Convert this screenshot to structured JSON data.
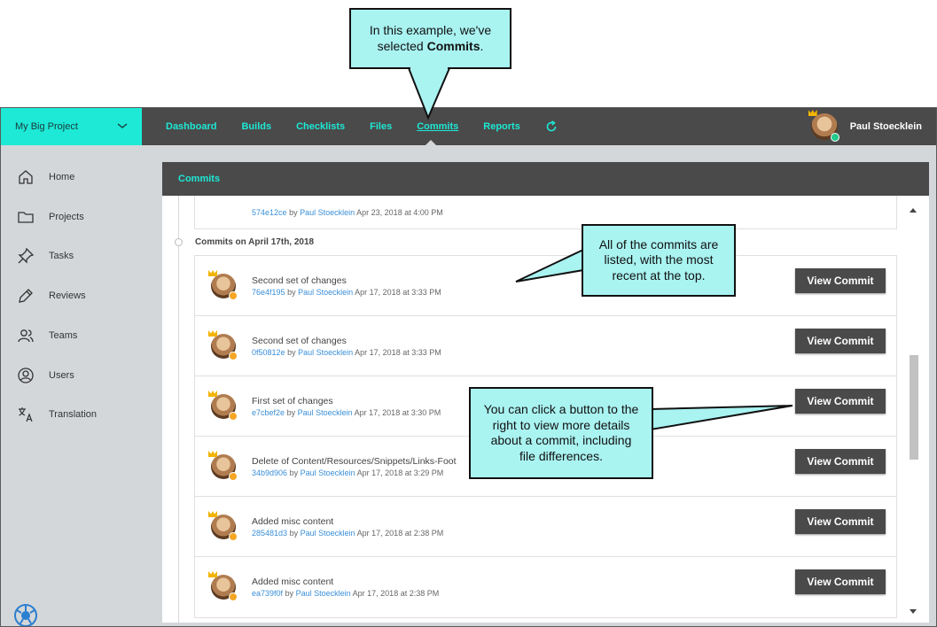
{
  "project": {
    "name": "My Big Project"
  },
  "nav": {
    "items": [
      "Dashboard",
      "Builds",
      "Checklists",
      "Files",
      "Commits",
      "Reports"
    ],
    "active": "Commits"
  },
  "user": {
    "name": "Paul Stoecklein"
  },
  "sidebar": {
    "items": [
      {
        "label": "Home",
        "icon": "home-icon"
      },
      {
        "label": "Projects",
        "icon": "folder-icon"
      },
      {
        "label": "Tasks",
        "icon": "pin-icon"
      },
      {
        "label": "Reviews",
        "icon": "pen-icon"
      },
      {
        "label": "Teams",
        "icon": "team-icon"
      },
      {
        "label": "Users",
        "icon": "user-icon"
      },
      {
        "label": "Translation",
        "icon": "translate-icon"
      }
    ]
  },
  "panel": {
    "title": "Commits"
  },
  "previous_commit": {
    "hash": "574e12ce",
    "by": "by",
    "author": "Paul Stoecklein",
    "date": "Apr 23, 2018 at 4:00 PM"
  },
  "date_group": "Commits on April 17th, 2018",
  "commits": [
    {
      "title": "Second set of changes",
      "hash": "76e4f195",
      "by": "by",
      "author": "Paul Stoecklein",
      "date": "Apr 17, 2018 at 3:33 PM",
      "button": "View Commit"
    },
    {
      "title": "Second set of changes",
      "hash": "0f50812e",
      "by": "by",
      "author": "Paul Stoecklein",
      "date": "Apr 17, 2018 at 3:33 PM",
      "button": "View Commit"
    },
    {
      "title": "First set of changes",
      "hash": "e7cbef2e",
      "by": "by",
      "author": "Paul Stoecklein",
      "date": "Apr 17, 2018 at 3:30 PM",
      "button": "View Commit"
    },
    {
      "title": "Delete of Content/Resources/Snippets/Links-Foot",
      "hash": "34b9d906",
      "by": "by",
      "author": "Paul Stoecklein",
      "date": "Apr 17, 2018 at 3:29 PM",
      "button": "View Commit"
    },
    {
      "title": "Added misc content",
      "hash": "285481d3",
      "by": "by",
      "author": "Paul Stoecklein",
      "date": "Apr 17, 2018 at 2:38 PM",
      "button": "View Commit"
    },
    {
      "title": "Added misc content",
      "hash": "ea739f0f",
      "by": "by",
      "author": "Paul Stoecklein",
      "date": "Apr 17, 2018 at 2:38 PM",
      "button": "View Commit"
    }
  ],
  "callouts": {
    "top_line1": "In this example, we've",
    "top_line2_prefix": "selected ",
    "top_line2_bold": "Commits",
    "top_line2_suffix": ".",
    "list": "All of the commits are listed, with the most recent at the top.",
    "button": "You can click a button to the right to view more details about a commit, including file differences."
  },
  "colors": {
    "accent": "#1de9d6",
    "bar": "#4a4a4a",
    "callout": "#a9f3f1",
    "link": "#3a8fd8"
  }
}
